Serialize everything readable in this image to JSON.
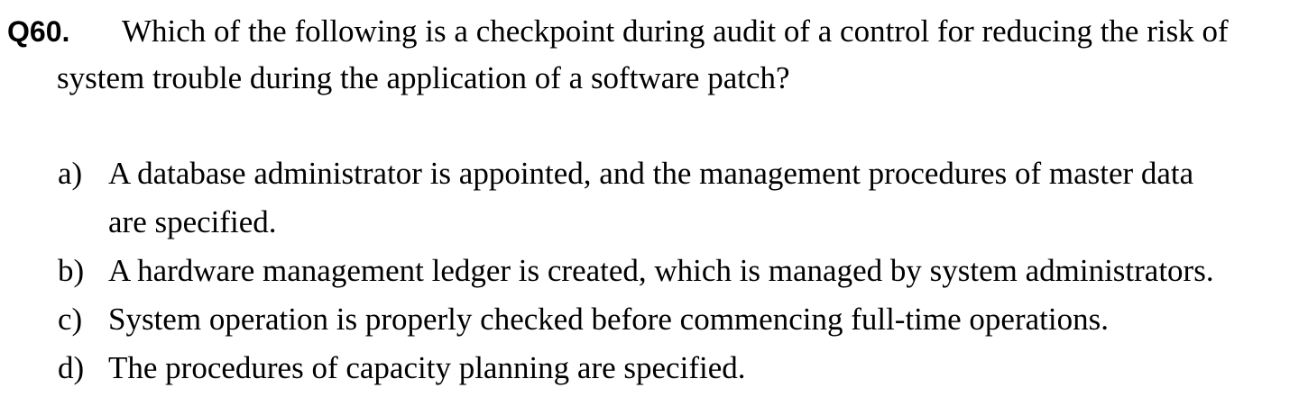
{
  "question": {
    "number": "Q60.",
    "text_line1": "Which of the following is a checkpoint during audit of a control for reducing the risk of",
    "text_line2": "system trouble during the application of a software patch?"
  },
  "options": [
    {
      "letter": "a)",
      "line1": "A database administrator is appointed, and the management procedures of master data",
      "line2": "are specified."
    },
    {
      "letter": "b)",
      "line1": "A hardware management ledger is created, which is managed by system administrators."
    },
    {
      "letter": "c)",
      "line1": "System operation is properly checked before commencing full-time operations."
    },
    {
      "letter": "d)",
      "line1": "The procedures of capacity planning are specified."
    }
  ]
}
